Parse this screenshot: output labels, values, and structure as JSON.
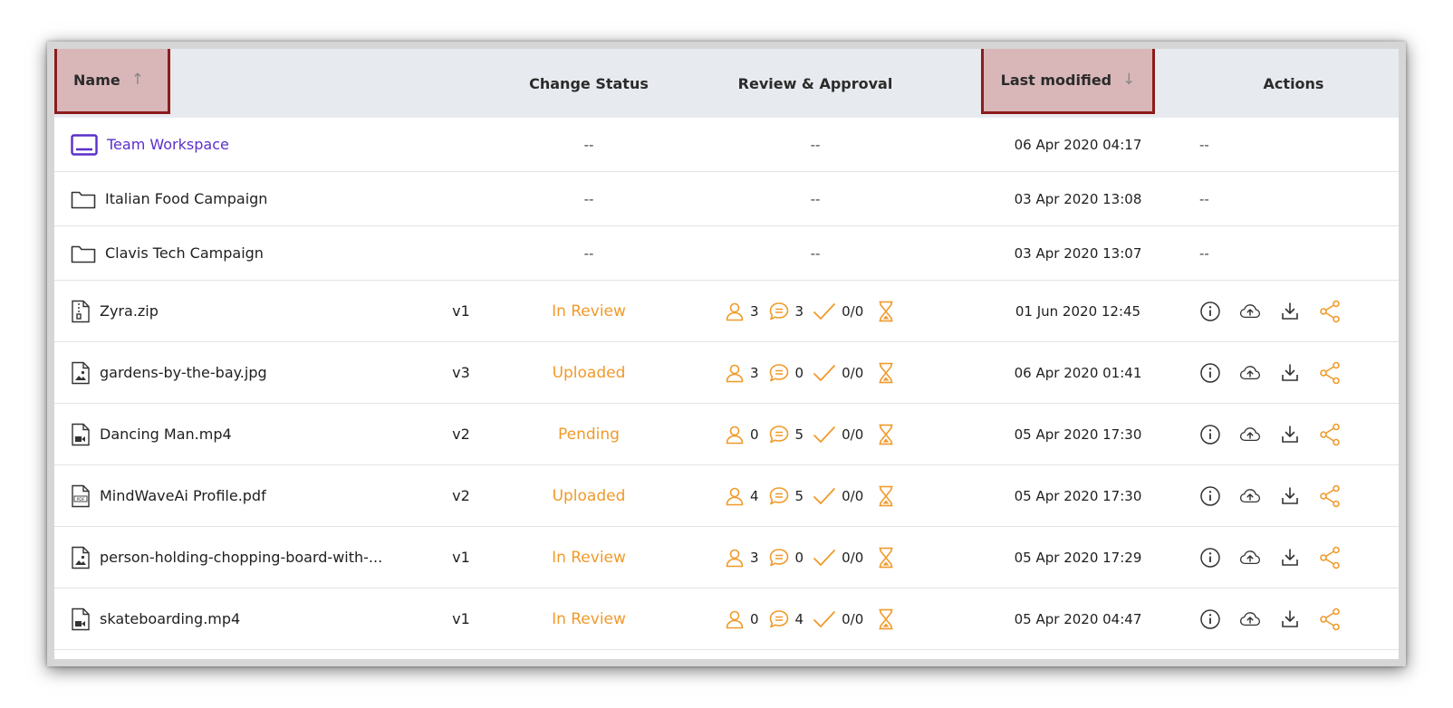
{
  "columns": {
    "name": "Name",
    "change_status": "Change Status",
    "review_approval": "Review & Approval",
    "last_modified": "Last modified",
    "actions": "Actions"
  },
  "sort": {
    "name_arrow": "↑",
    "modified_arrow": "↓"
  },
  "placeholder": "--",
  "rows": [
    {
      "type": "workspace",
      "icon": "workspace-icon",
      "name": "Team Workspace",
      "version": "",
      "status": "--",
      "modified": "06 Apr 2020 04:17",
      "actions": "--"
    },
    {
      "type": "folder",
      "icon": "folder-icon",
      "name": "Italian Food Campaign",
      "version": "",
      "status": "--",
      "modified": "03 Apr 2020 13:08",
      "actions": "--"
    },
    {
      "type": "folder",
      "icon": "folder-icon",
      "name": "Clavis Tech Campaign",
      "version": "",
      "status": "--",
      "modified": "03 Apr 2020 13:07",
      "actions": "--"
    },
    {
      "type": "file",
      "icon": "zip-file-icon",
      "name": "Zyra.zip",
      "version": "v1",
      "status": "In Review",
      "reviewers": "3",
      "comments": "3",
      "approvals": "0/0",
      "modified": "01 Jun 2020 12:45"
    },
    {
      "type": "file",
      "icon": "image-file-icon",
      "name": "gardens-by-the-bay.jpg",
      "version": "v3",
      "status": "Uploaded",
      "reviewers": "3",
      "comments": "0",
      "approvals": "0/0",
      "modified": "06 Apr 2020 01:41"
    },
    {
      "type": "file",
      "icon": "video-file-icon",
      "name": "Dancing Man.mp4",
      "version": "v2",
      "status": "Pending",
      "reviewers": "0",
      "comments": "5",
      "approvals": "0/0",
      "modified": "05 Apr 2020 17:30"
    },
    {
      "type": "file",
      "icon": "pdf-file-icon",
      "name": "MindWaveAi Profile.pdf",
      "version": "v2",
      "status": "Uploaded",
      "reviewers": "4",
      "comments": "5",
      "approvals": "0/0",
      "modified": "05 Apr 2020 17:30"
    },
    {
      "type": "file",
      "icon": "image-file-icon",
      "name": "person-holding-chopping-board-with-...",
      "version": "v1",
      "status": "In Review",
      "reviewers": "3",
      "comments": "0",
      "approvals": "0/0",
      "modified": "05 Apr 2020 17:29"
    },
    {
      "type": "file",
      "icon": "video-file-icon",
      "name": "skateboarding.mp4",
      "version": "v1",
      "status": "In Review",
      "reviewers": "0",
      "comments": "4",
      "approvals": "0/0",
      "modified": "05 Apr 2020 04:47"
    }
  ],
  "colors": {
    "accent_orange": "#f09a2a",
    "workspace_purple": "#5b2fc8",
    "sort_highlight": "#d9b7b9",
    "sort_border": "#8c1c1c"
  },
  "action_icons": [
    "info-icon",
    "cloud-upload-icon",
    "download-icon",
    "share-icon"
  ],
  "review_icons": [
    "reviewers-icon",
    "comments-icon",
    "approval-check-icon",
    "pending-hourglass-icon"
  ]
}
